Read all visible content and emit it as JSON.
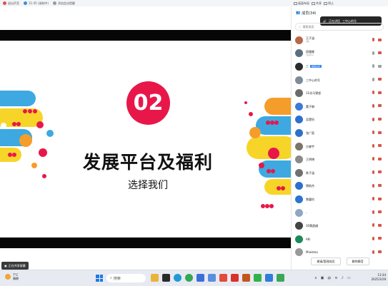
{
  "topbar": {
    "items": [
      "退出声音",
      "11:45 (录制中)",
      "添加会议提醒"
    ]
  },
  "topbar_right": {
    "items": [
      "画面布局",
      "共享",
      "停止"
    ]
  },
  "slide": {
    "number": "02",
    "title": "发展平台及福利",
    "subtitle": "选择我们",
    "accent_color": "#e8174a"
  },
  "screen_share_label": "正在共享屏幕",
  "panel": {
    "title": "成员(34)",
    "tooltip_name": "正在讲话",
    "tooltip_text": "三中心的号",
    "search_placeholder": "搜索成员",
    "members": [
      {
        "name": "王子涵",
        "sub": "(我)",
        "color": "#b8674b",
        "mic": "red",
        "cam": "red"
      },
      {
        "name": "邵雅娜",
        "sub": "(主持人)",
        "color": "#5e6c80",
        "mic": "gray",
        "cam": "red"
      },
      {
        "name": "三",
        "sub": "",
        "tag": "联席主持",
        "color": "#2c2c2c",
        "mic": "gray",
        "cam": "gray"
      },
      {
        "name": "三中心的号",
        "sub": "",
        "color": "#7d8b99",
        "mic": "gray",
        "cam": "red"
      },
      {
        "name": "11坊马锦程",
        "sub": "",
        "color": "#6a6a6a",
        "mic": "red",
        "cam": "red"
      },
      {
        "name": "董子琳",
        "sub": "",
        "color": "#3d7ad8",
        "mic": "red",
        "cam": "red"
      },
      {
        "name": "吴楚怡",
        "sub": "",
        "color": "#2f6fcf",
        "mic": "red",
        "cam": "red"
      },
      {
        "name": "张广笛",
        "sub": "",
        "color": "#2a72c8",
        "mic": "red",
        "cam": "red"
      },
      {
        "name": "方睿宇",
        "sub": "",
        "color": "#7b7467",
        "mic": "red",
        "cam": "red"
      },
      {
        "name": "王明博",
        "sub": "",
        "color": "#8a8a8a",
        "mic": "red",
        "cam": "red"
      },
      {
        "name": "陈子涵",
        "sub": "",
        "color": "#707070",
        "mic": "red",
        "cam": "red"
      },
      {
        "name": "锦航杰",
        "sub": "",
        "color": "#2d6fcd",
        "mic": "red",
        "cam": "red"
      },
      {
        "name": "黎露怡",
        "sub": "",
        "color": "#2c74d0",
        "mic": "red",
        "cam": "red"
      },
      {
        "name": "-",
        "sub": "",
        "color": "#8fa7c3",
        "mic": "red",
        "cam": "red"
      },
      {
        "name": "30黄超越",
        "sub": "",
        "color": "#444444",
        "mic": "red",
        "cam": "red"
      },
      {
        "name": "AKi",
        "sub": "",
        "color": "#1e8a5c",
        "mic": "red",
        "cam": "red"
      },
      {
        "name": "Miaistea",
        "sub": "",
        "color": "#999999",
        "mic": "red",
        "cam": "red"
      }
    ],
    "invite_button": "邀请/管理成员",
    "mute_button": "解除静音"
  },
  "taskbar": {
    "weather_temp": "7°C",
    "weather_desc": "晴朗",
    "search_placeholder": "搜索",
    "time": "13:34",
    "date": "2025/3/28"
  }
}
